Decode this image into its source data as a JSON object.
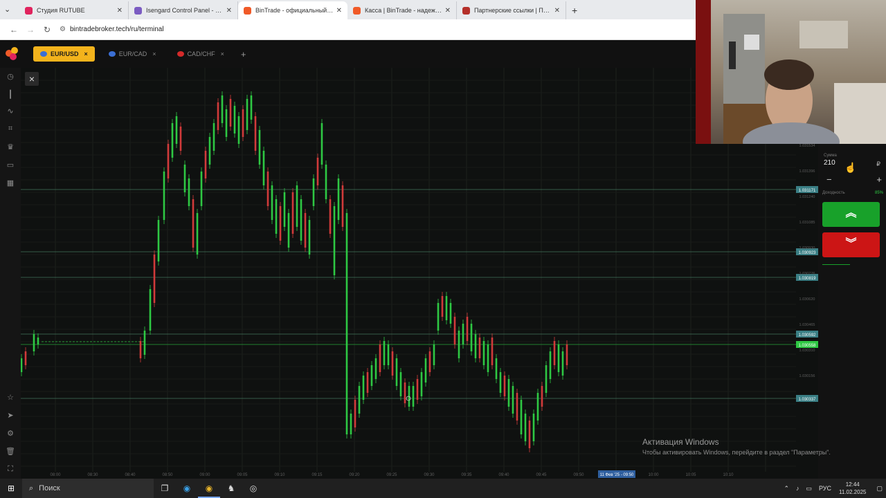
{
  "browser": {
    "tabs": [
      {
        "title": "Студия RUTUBE",
        "color": "#e0245e"
      },
      {
        "title": "Isengard Control Panel - Стран",
        "color": "#7b5cc2"
      },
      {
        "title": "BinTrade - официальный сайт",
        "color": "#f05a28",
        "active": true
      },
      {
        "title": "Касса | BinTrade - надежная тр",
        "color": "#f05a28"
      },
      {
        "title": "Партнерские ссылки | Партне",
        "color": "#b5302a"
      }
    ],
    "new_tab": "+",
    "url": "bintradebroker.tech/ru/terminal"
  },
  "assets": [
    {
      "label": "EUR/USD",
      "active": true
    },
    {
      "label": "EUR/CAD"
    },
    {
      "label": "CAD/CHF"
    }
  ],
  "add_asset": "+",
  "close": "×",
  "chart": {
    "price_labels": [
      "1.031171",
      "1.030923",
      "1.030819",
      "1.030592",
      "1.030558",
      "1.030337"
    ],
    "y_ticks": [
      "1.031534",
      "1.031396",
      "1.031240",
      "1.031085",
      "1.030930",
      "1.030776",
      "1.030620",
      "1.030465",
      "1.030310",
      "1.030156"
    ],
    "x_ticks": [
      "08:00",
      "08:30",
      "08:40",
      "08:50",
      "09:00",
      "09:05",
      "09:10",
      "09:15",
      "09:20",
      "09:25",
      "09:30",
      "09:35",
      "09:40",
      "09:45",
      "09:50",
      "09:55",
      "10:00",
      "10:05",
      "10:10"
    ],
    "time_badge": "11 Фев '25 - 09:50"
  },
  "panel": {
    "amount_label": "Сумма",
    "amount": "210",
    "currency": "₽",
    "minus": "−",
    "plus": "+",
    "payout_label": "Доходность",
    "payout_value": "85%"
  },
  "watermark": {
    "line1": "Активация Windows",
    "line2": "Чтобы активировать Windows, перейдите в раздел \"Параметры\"."
  },
  "taskbar": {
    "search": "Поиск",
    "lang": "РУС",
    "time": "12:44",
    "date": "11.02.2025"
  }
}
